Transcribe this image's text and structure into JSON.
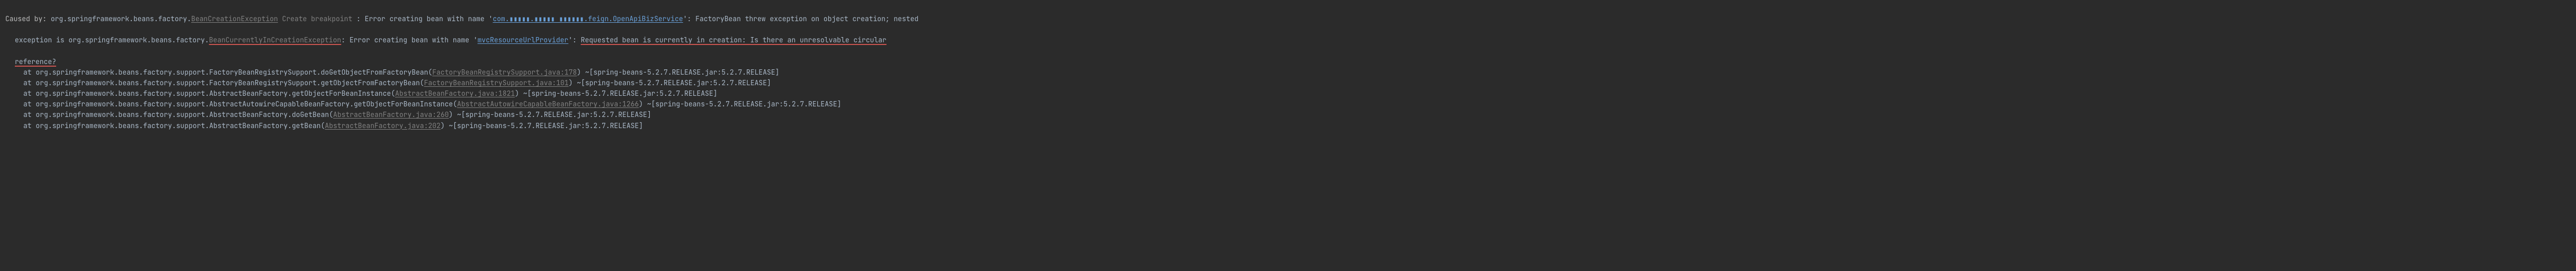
{
  "exception": {
    "caused_by": "Caused by:",
    "outer_exception_pkg": "org.springframework.beans.factory.",
    "outer_exception_cls": "BeanCreationException",
    "breakpoint": " Create breakpoint ",
    "msg1_a": ": Error creating bean with name '",
    "bean1_prefix": "com.",
    "bean1_masked": "▮▮▮▮▮.▮▮▮▮▮ ▮▮▮▮▮▮",
    "bean1_suffix": ".feign.OpenApiBizService",
    "msg1_b": "': FactoryBean threw exception on object creation; nested",
    "msg2_a": "exception is org.springframework.beans.factory.",
    "inner_exception_cls": "BeanCurrentlyInCreationException",
    "msg2_b": ": Error creating bean with name '",
    "bean2": "mvcResourceUrlProvider",
    "msg2_c": "': ",
    "circular_a": "Requested bean is currently in creation: Is there an unresolvable circular",
    "circular_b": "reference?"
  },
  "stack": [
    {
      "prefix": "at org.springframework.beans.factory.support.FactoryBeanRegistrySupport.doGetObjectFromFactoryBean(",
      "src": "FactoryBeanRegistrySupport.java:178",
      "suffix": ") ~[spring-beans-5.2.7.RELEASE.jar:5.2.7.RELEASE]"
    },
    {
      "prefix": "at org.springframework.beans.factory.support.FactoryBeanRegistrySupport.getObjectFromFactoryBean(",
      "src": "FactoryBeanRegistrySupport.java:101",
      "suffix": ") ~[spring-beans-5.2.7.RELEASE.jar:5.2.7.RELEASE]"
    },
    {
      "prefix": "at org.springframework.beans.factory.support.AbstractBeanFactory.getObjectForBeanInstance(",
      "src": "AbstractBeanFactory.java:1821",
      "suffix": ") ~[spring-beans-5.2.7.RELEASE.jar:5.2.7.RELEASE]"
    },
    {
      "prefix": "at org.springframework.beans.factory.support.AbstractAutowireCapableBeanFactory.getObjectForBeanInstance(",
      "src": "AbstractAutowireCapableBeanFactory.java:1266",
      "suffix": ") ~[spring-beans-5.2.7.RELEASE.jar:5.2.7.RELEASE]"
    },
    {
      "prefix": "at org.springframework.beans.factory.support.AbstractBeanFactory.doGetBean(",
      "src": "AbstractBeanFactory.java:260",
      "suffix": ") ~[spring-beans-5.2.7.RELEASE.jar:5.2.7.RELEASE]"
    },
    {
      "prefix": "at org.springframework.beans.factory.support.AbstractBeanFactory.getBean(",
      "src": "AbstractBeanFactory.java:202",
      "suffix": ") ~[spring-beans-5.2.7.RELEASE.jar:5.2.7.RELEASE]"
    }
  ]
}
